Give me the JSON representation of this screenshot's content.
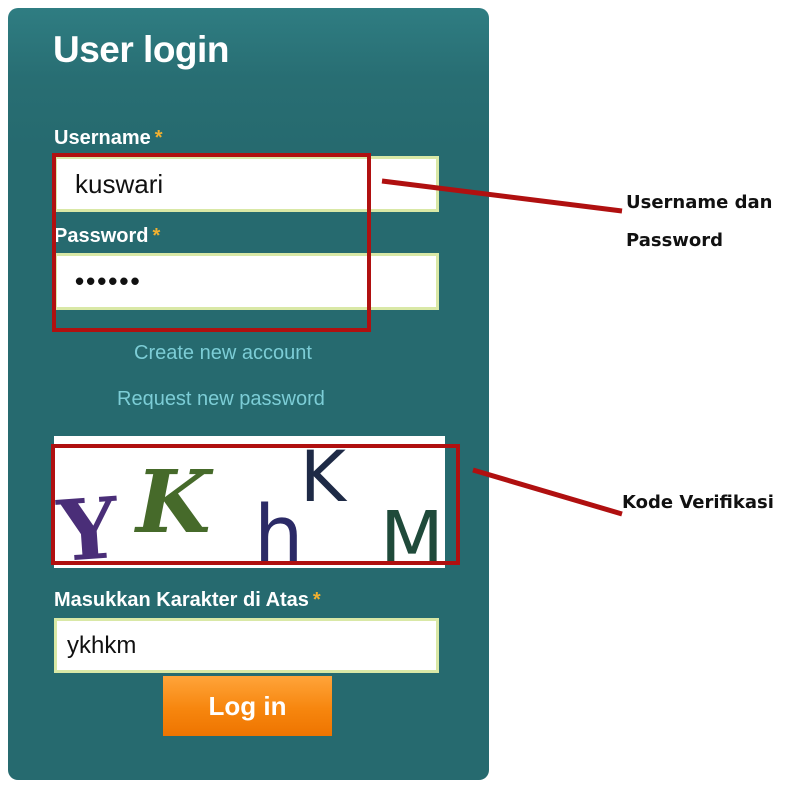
{
  "login": {
    "title": "User login",
    "username_label": "Username",
    "password_label": "Password",
    "required_mark": "*",
    "username_value": "kuswari",
    "password_value": "••••••",
    "create_account_link": "Create new account",
    "request_password_link": "Request new password",
    "captcha_label": "Masukkan Karakter di Atas",
    "captcha_value": "ykhkm",
    "login_button": "Log in"
  },
  "captcha_image": {
    "characters": [
      "Y",
      "K",
      "h",
      "K",
      "M"
    ]
  },
  "annotations": {
    "credentials_label_line1": "Username dan",
    "credentials_label_line2": "Password",
    "captcha_callout": "Kode Verifikasi"
  },
  "colors": {
    "panel": "#266a6f",
    "label": "#ffffff",
    "required": "#f0b030",
    "link": "#7ccdd6",
    "button": "#f7860e",
    "highlight": "#b01010"
  }
}
